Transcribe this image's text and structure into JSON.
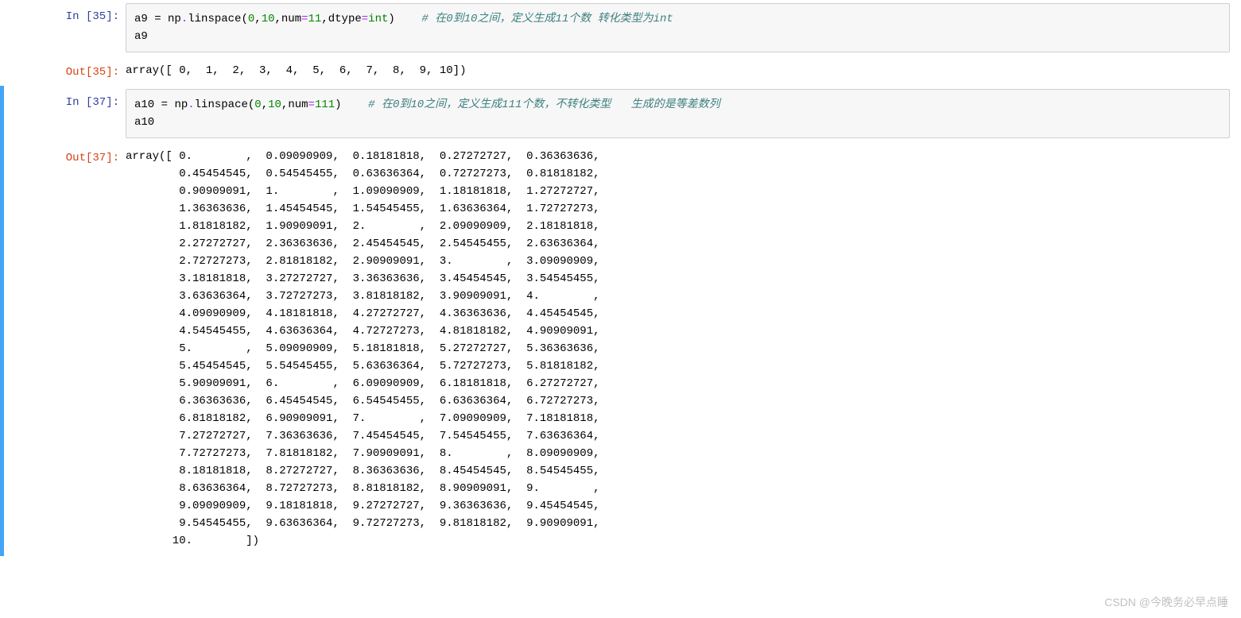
{
  "cells": [
    {
      "selected": false,
      "in_prompt": "In  [35]:",
      "out_prompt": "Out[35]:",
      "code_line1": {
        "var": "a9",
        "eq": " = ",
        "mod": "np",
        "dot": ".",
        "fn": "linspace",
        "lp": "(",
        "n1": "0",
        "c1": ",",
        "n2": "10",
        "c2": ",",
        "kw1": "num",
        "a1": "=",
        "n3": "11",
        "c3": ",",
        "kw2": "dtype",
        "a2": "=",
        "bi": "int",
        "rp": ")",
        "pad": "    ",
        "cm": "# 在0到10之间，定义生成11个数 转化类型为int"
      },
      "code_line2": "a9",
      "output": "array([ 0,  1,  2,  3,  4,  5,  6,  7,  8,  9, 10])"
    },
    {
      "selected": true,
      "in_prompt": "In  [37]:",
      "out_prompt": "Out[37]:",
      "code_line1": {
        "var": "a10",
        "eq": " = ",
        "mod": "np",
        "dot": ".",
        "fn": "linspace",
        "lp": "(",
        "n1": "0",
        "c1": ",",
        "n2": "10",
        "c2": ",",
        "kw1": "num",
        "a1": "=",
        "n3": "111",
        "rp": ")",
        "pad": "    ",
        "cm": "# 在0到10之间，定义生成111个数，不转化类型   生成的是等差数列"
      },
      "code_line2": "a10",
      "output": "array([ 0.        ,  0.09090909,  0.18181818,  0.27272727,  0.36363636,\n        0.45454545,  0.54545455,  0.63636364,  0.72727273,  0.81818182,\n        0.90909091,  1.        ,  1.09090909,  1.18181818,  1.27272727,\n        1.36363636,  1.45454545,  1.54545455,  1.63636364,  1.72727273,\n        1.81818182,  1.90909091,  2.        ,  2.09090909,  2.18181818,\n        2.27272727,  2.36363636,  2.45454545,  2.54545455,  2.63636364,\n        2.72727273,  2.81818182,  2.90909091,  3.        ,  3.09090909,\n        3.18181818,  3.27272727,  3.36363636,  3.45454545,  3.54545455,\n        3.63636364,  3.72727273,  3.81818182,  3.90909091,  4.        ,\n        4.09090909,  4.18181818,  4.27272727,  4.36363636,  4.45454545,\n        4.54545455,  4.63636364,  4.72727273,  4.81818182,  4.90909091,\n        5.        ,  5.09090909,  5.18181818,  5.27272727,  5.36363636,\n        5.45454545,  5.54545455,  5.63636364,  5.72727273,  5.81818182,\n        5.90909091,  6.        ,  6.09090909,  6.18181818,  6.27272727,\n        6.36363636,  6.45454545,  6.54545455,  6.63636364,  6.72727273,\n        6.81818182,  6.90909091,  7.        ,  7.09090909,  7.18181818,\n        7.27272727,  7.36363636,  7.45454545,  7.54545455,  7.63636364,\n        7.72727273,  7.81818182,  7.90909091,  8.        ,  8.09090909,\n        8.18181818,  8.27272727,  8.36363636,  8.45454545,  8.54545455,\n        8.63636364,  8.72727273,  8.81818182,  8.90909091,  9.        ,\n        9.09090909,  9.18181818,  9.27272727,  9.36363636,  9.45454545,\n        9.54545455,  9.63636364,  9.72727273,  9.81818182,  9.90909091,\n       10.        ])"
    }
  ],
  "watermark": "CSDN @今晚务必早点睡"
}
